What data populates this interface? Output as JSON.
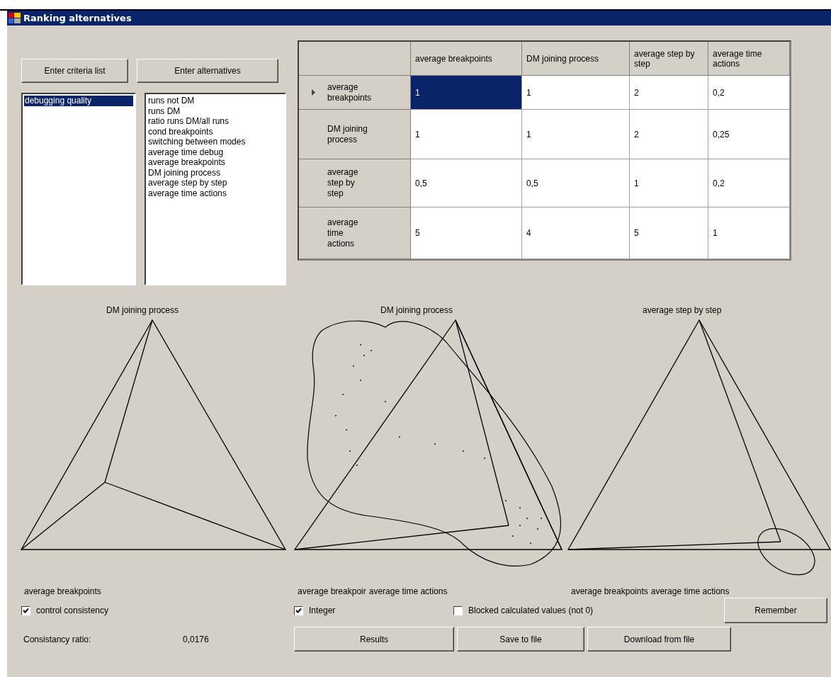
{
  "window": {
    "title": "Ranking alternatives"
  },
  "top_buttons": [
    "Enter criteria list",
    "Enter alternatives"
  ],
  "criteria_list": [
    {
      "label": "debugging quality",
      "selected": true
    }
  ],
  "alternatives_list": [
    {
      "label": "runs not DM",
      "selected": false
    },
    {
      "label": "runs DM",
      "selected": false
    },
    {
      "label": "ratio runs DM/all runs",
      "selected": false
    },
    {
      "label": "cond breakpoints",
      "selected": false
    },
    {
      "label": "switching between modes",
      "selected": false
    },
    {
      "label": "average time debug",
      "selected": false
    },
    {
      "label": "average breakpoints",
      "selected": false
    },
    {
      "label": "DM joining process",
      "selected": false
    },
    {
      "label": "average step by step",
      "selected": false
    },
    {
      "label": "average time actions",
      "selected": false
    }
  ],
  "table": {
    "columns": [
      "average breakpoints",
      "DM joining process",
      "average step by step",
      "average time actions"
    ],
    "rows": [
      {
        "header": "average breakpoints",
        "current": true,
        "cells": [
          {
            "value": "1",
            "selected": true
          },
          {
            "value": "1",
            "selected": false
          },
          {
            "value": "2",
            "selected": false
          },
          {
            "value": "0,2",
            "selected": false
          }
        ]
      },
      {
        "header": "DM joining process",
        "current": false,
        "cells": [
          {
            "value": "1",
            "selected": false
          },
          {
            "value": "1",
            "selected": false
          },
          {
            "value": "2",
            "selected": false
          },
          {
            "value": "0,25",
            "selected": false
          }
        ]
      },
      {
        "header": "average step by step",
        "current": false,
        "cells": [
          {
            "value": "0,5",
            "selected": false
          },
          {
            "value": "0,5",
            "selected": false
          },
          {
            "value": "1",
            "selected": false
          },
          {
            "value": "0,2",
            "selected": false
          }
        ]
      },
      {
        "header": "average time actions",
        "current": false,
        "cells": [
          {
            "value": "5",
            "selected": false
          },
          {
            "value": "4",
            "selected": false
          },
          {
            "value": "5",
            "selected": false
          },
          {
            "value": "1",
            "selected": false
          }
        ]
      }
    ]
  },
  "triangles": [
    {
      "top_label": "DM joining process",
      "bottom_labels": [
        "average breakpoints"
      ],
      "kind": "plain"
    },
    {
      "top_label": "DM joining process",
      "bottom_labels": [
        "average breakpoir",
        "average time actions"
      ],
      "kind": "region"
    },
    {
      "top_label": "average step by step",
      "bottom_labels": [
        "average breakpoints",
        "average time actions"
      ],
      "kind": "ellipse"
    }
  ],
  "checkboxes": [
    {
      "label": "control consistency",
      "checked": true
    },
    {
      "label": "Integer",
      "checked": true
    },
    {
      "label": "Blocked calculated values (not 0)",
      "checked": false
    }
  ],
  "consistency": {
    "label": "Consistancy ratio:",
    "value": "0,0176"
  },
  "buttons": {
    "remember": "Remember",
    "actions": [
      "Results",
      "Save to file",
      "Download from file"
    ]
  }
}
